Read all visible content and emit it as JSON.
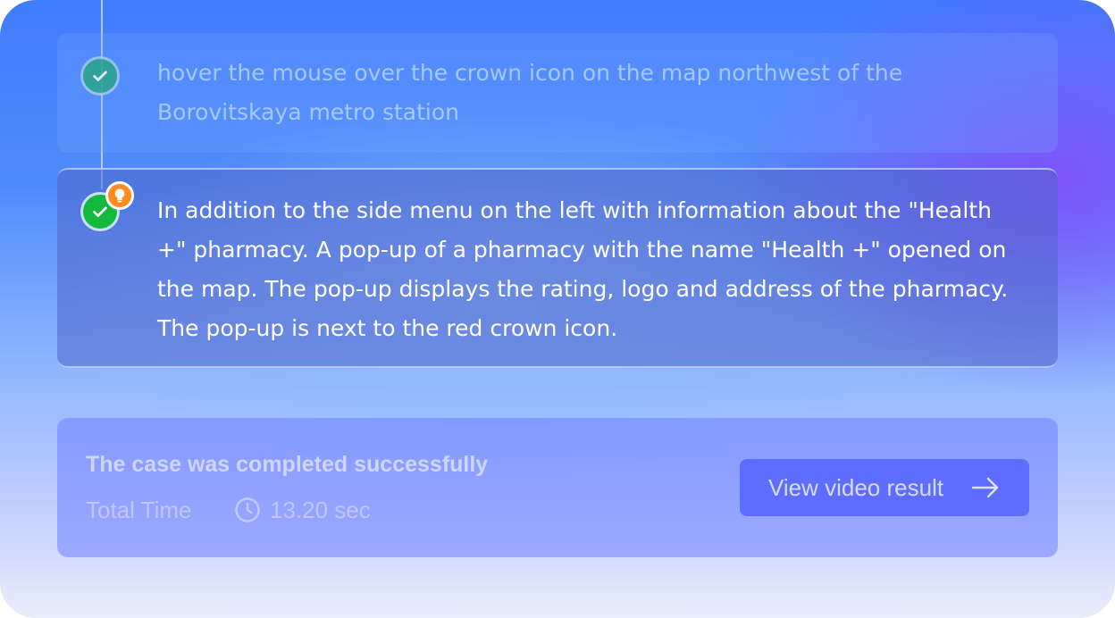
{
  "steps": [
    {
      "status": "done",
      "icon": "check-icon",
      "text": "hover the mouse over the crown icon on the map northwest of the Borovitskaya metro station"
    },
    {
      "status": "active",
      "icon": "check-icon",
      "badge_icon": "lightbulb-icon",
      "text": "In addition to the side menu on the left with information about the \"Health +\" pharmacy. A pop-up of a pharmacy with the name \"Health +\" opened on the map. The pop-up displays the rating, logo and address of the pharmacy. The pop-up is next to the red crown icon."
    }
  ],
  "result": {
    "title": "The case was completed successfully",
    "time_label": "Total Time",
    "time_icon": "clock-icon",
    "time_value": "13.20 sec",
    "button_label": "View video result",
    "button_icon": "arrow-right-icon"
  },
  "colors": {
    "success_check": "#12b93e",
    "done_check": "#2aa58a",
    "badge": "#ff8a1e",
    "button": "#5564ff"
  }
}
